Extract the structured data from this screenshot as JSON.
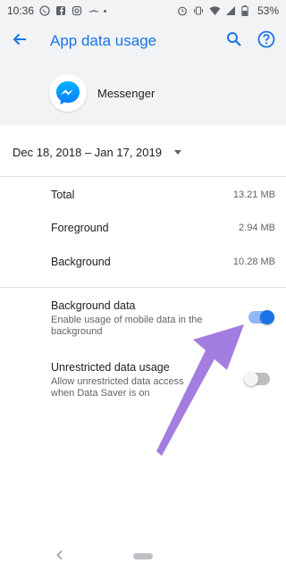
{
  "status_bar": {
    "time": "10:36",
    "battery": "53%"
  },
  "app_bar": {
    "title": "App data usage"
  },
  "app": {
    "name": "Messenger"
  },
  "date_range": {
    "value": "Dec 18, 2018 – Jan 17, 2019"
  },
  "usage": [
    {
      "label": "Total",
      "value": "13.21 MB"
    },
    {
      "label": "Foreground",
      "value": "2.94 MB"
    },
    {
      "label": "Background",
      "value": "10.28 MB"
    }
  ],
  "settings": [
    {
      "title": "Background data",
      "subtitle": "Enable usage of mobile data in the background",
      "enabled": true
    },
    {
      "title": "Unrestricted data usage",
      "subtitle": "Allow unrestricted data access when Data Saver is on",
      "enabled": false
    }
  ],
  "colors": {
    "accent": "#1a73e8",
    "toggle_on_track": "#90b8f8",
    "toggle_off_track": "#bdbdbd",
    "arrow": "#a47de0"
  }
}
